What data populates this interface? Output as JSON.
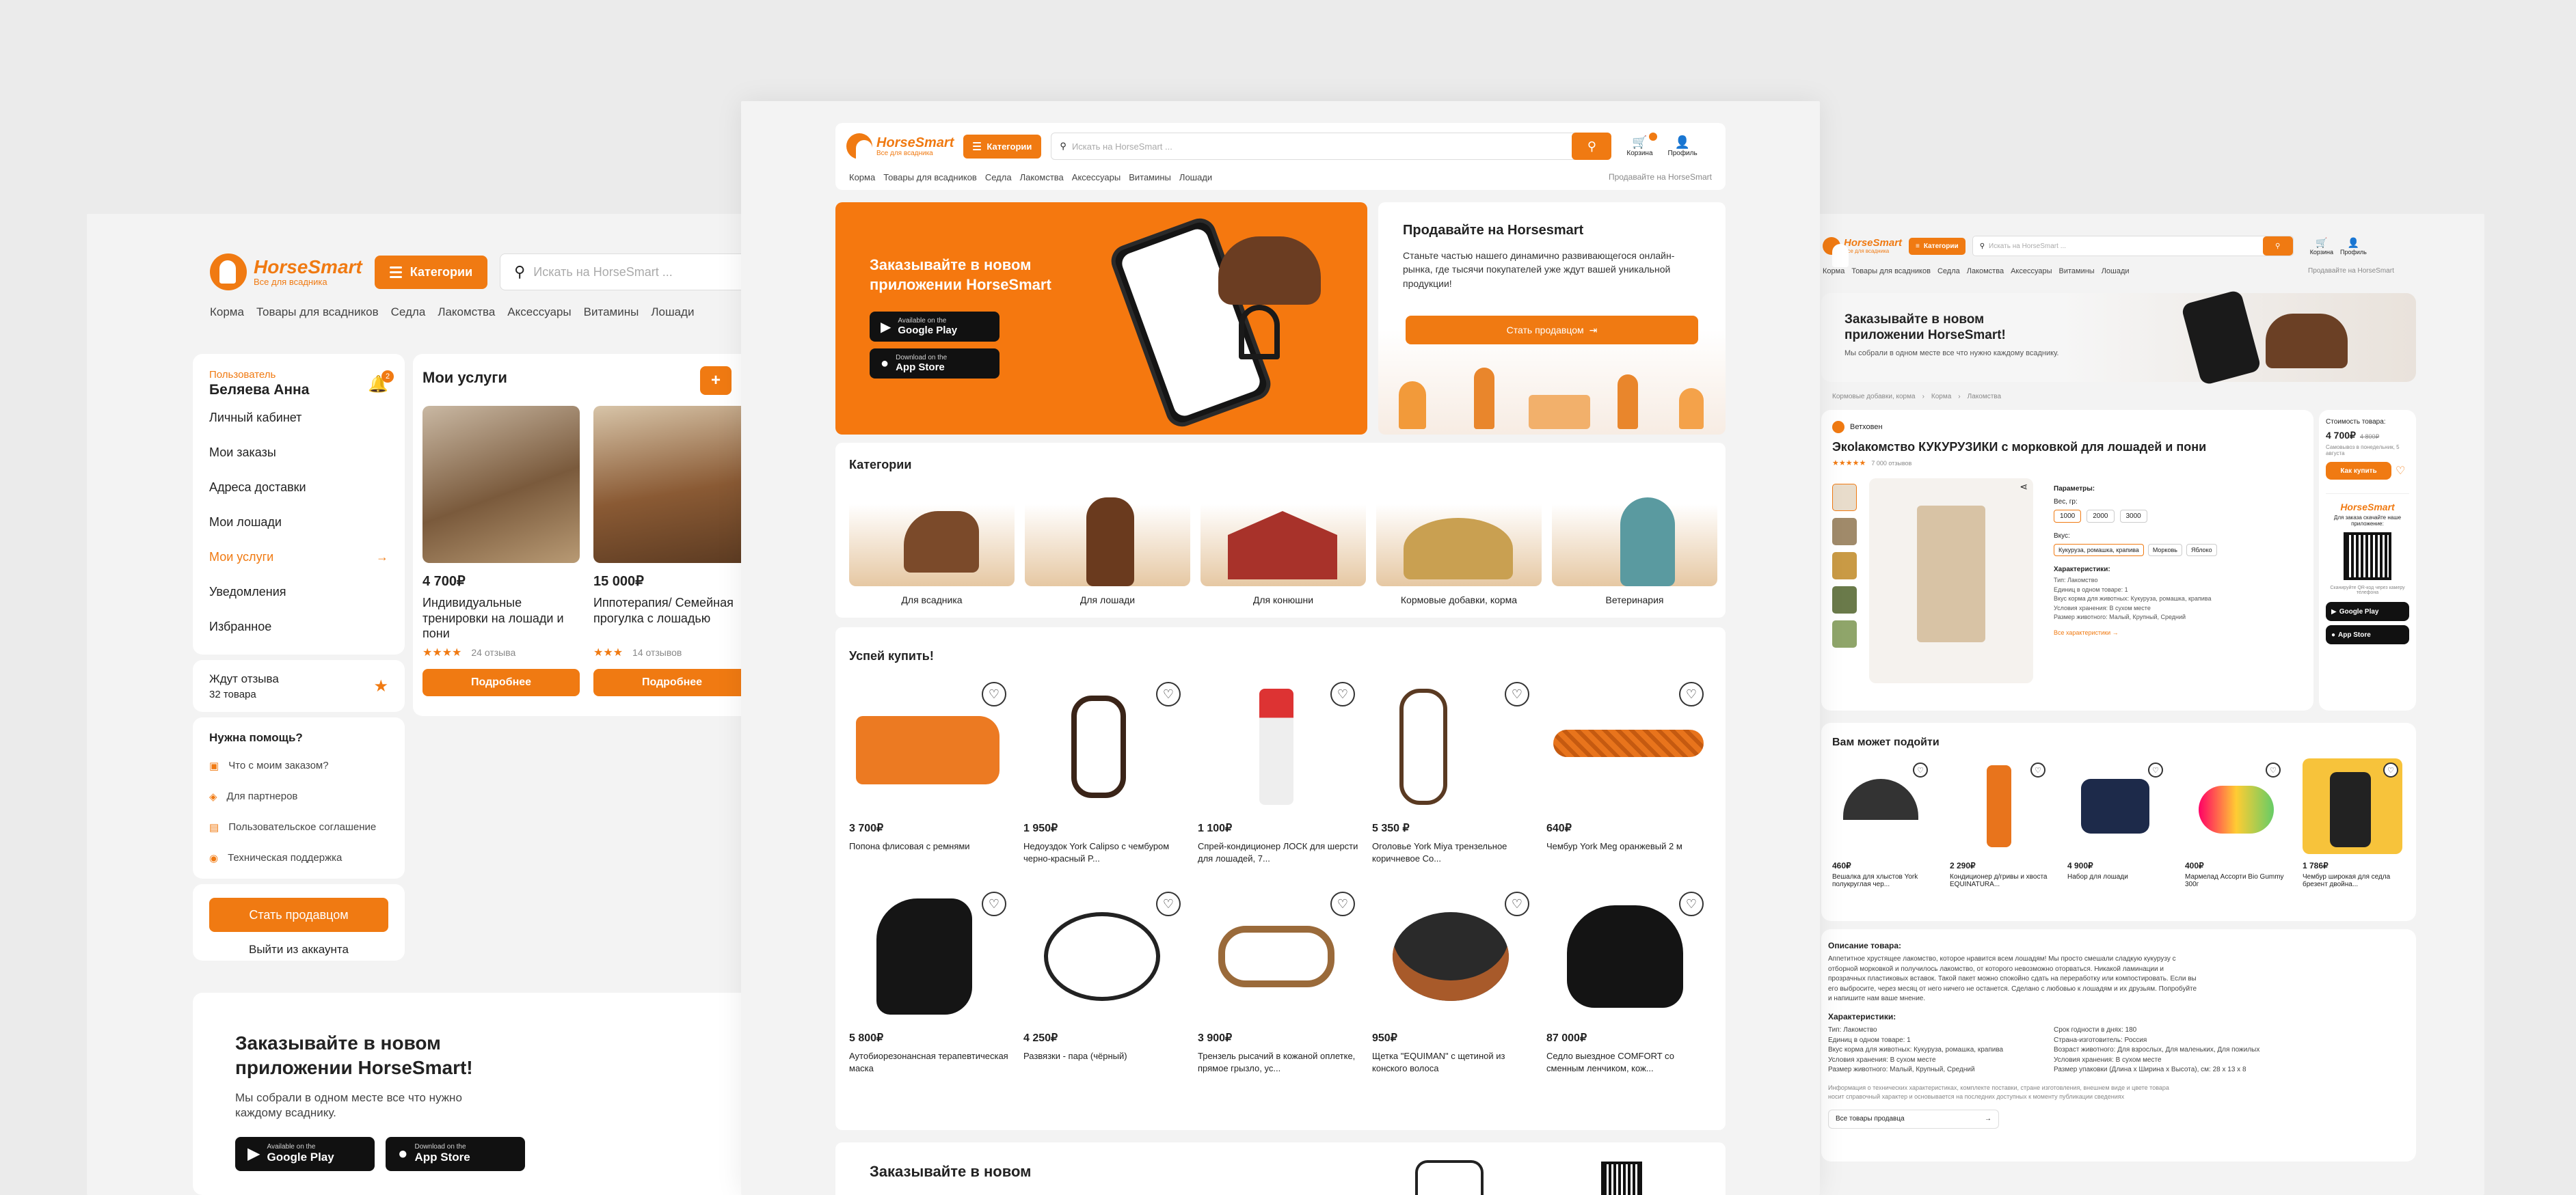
{
  "brand": {
    "name": "HorseSmart",
    "tagline": "Все для всадника"
  },
  "header": {
    "categories": "Категории",
    "search_placeholder": "Искать на HorseSmart ...",
    "cart": "Корзина",
    "profile": "Профиль",
    "sell": "Продавайте на HorseSmart"
  },
  "nav": [
    "Корма",
    "Товары для всадников",
    "Седла",
    "Лакомства",
    "Аксессуары",
    "Витамины",
    "Лошади"
  ],
  "left": {
    "user_role": "Пользователь",
    "user_name": "Беляева Анна",
    "notif_count": "2",
    "menu": [
      "Личный кабинет",
      "Мои заказы",
      "Адреса доставки",
      "Мои лошади",
      "Мои услуги",
      "Уведомления",
      "Избранное"
    ],
    "reviews_title": "Ждут отзыва",
    "reviews_count": "32 товара",
    "help_title": "Нужна помощь?",
    "help": [
      "Что с моим заказом?",
      "Для партнеров",
      "Пользовательское соглашение",
      "Техническая поддержка"
    ],
    "become_seller": "Стать продавцом",
    "logout": "Выйти из аккаунта",
    "services_title": "Мои услуги",
    "services": [
      {
        "price": "4 700₽",
        "title": "Индивидуальные тренировки на лошади и пони",
        "stars": "★★★★",
        "reviews": "24 отзыва",
        "btn": "Подробнее"
      },
      {
        "price": "15 000₽",
        "title": "Иппотерапия/ Семейная прогулка с лошадью",
        "stars": "★★★",
        "reviews": "14 отзывов",
        "btn": "Подробнее"
      }
    ],
    "promo_title": "Заказывайте в новом приложении HorseSmart!",
    "promo_text": "Мы собрали в одном месте все что нужно каждому всаднику."
  },
  "stores": {
    "gp_small": "Available on the",
    "gp": "Google Play",
    "as_small": "Download on the",
    "as": "App Store"
  },
  "center": {
    "banner_title": "Заказывайте в новом приложении HorseSmart",
    "sell_title": "Продавайте на Horsesmart",
    "sell_text": "Станьте частью нашего динамично развивающегося онлайн-рынка, где тысячи покупателей уже ждут вашей уникальной продукции!",
    "sell_btn": "Стать продавцом",
    "categories_title": "Категории",
    "categories": [
      "Для всадника",
      "Для лошади",
      "Для конюшни",
      "Кормовые добавки, корма",
      "Ветеринария"
    ],
    "hurry_title": "Успей купить!",
    "products": [
      {
        "price": "3 700₽",
        "name": "Попона флисовая с ремнями"
      },
      {
        "price": "1 950₽",
        "name": "Недоуздок York Calipso с чембуром черно-красный P..."
      },
      {
        "price": "1 100₽",
        "name": "Спрей-кондиционер ЛОСК для шерсти для лошадей, 7..."
      },
      {
        "price": "5 350 ₽",
        "name": "Оголовье York Miya трензельное коричневое Co..."
      },
      {
        "price": "640₽",
        "name": "Чембур York Meg оранжевый 2 м"
      },
      {
        "price": "5 800₽",
        "name": "Аутобиорезонансная терапевтическая маска"
      },
      {
        "price": "4 250₽",
        "name": "Развязки - пара (чёрный)"
      },
      {
        "price": "3 900₽",
        "name": "Трензель рысачий в кожаной оплетке, прямое грызло, ус..."
      },
      {
        "price": "950₽",
        "name": "Щетка \"EQUIMAN\" с щетиной из конского волоса"
      },
      {
        "price": "87 000₽",
        "name": "Седло выездное COMFORT со сменным ленчиком, кож..."
      }
    ],
    "bottom_promo": "Заказывайте в новом"
  },
  "right": {
    "banner_title": "Заказывайте в новом приложении HorseSmart!",
    "banner_text": "Мы собрали в одном месте все что нужно каждому всаднику.",
    "breadcrumbs": [
      "Кормовые добавки, корма",
      "Корма",
      "Лакомства"
    ],
    "seller": "Ветховен",
    "title": "Экolакомство КУКУРУЗИКИ с морковкой для лошадей и пони",
    "rating": "★★★★★",
    "reviews": "7 000 отзывов",
    "params_title": "Параметры:",
    "weight_label": "Вес, гр:",
    "weights": [
      "1000",
      "2000",
      "3000"
    ],
    "taste_label": "Вкус:",
    "tastes": [
      "Кукуруза, ромашка, крапива",
      "Морковь",
      "Яблоко"
    ],
    "chars_title": "Характеристики:",
    "chars": [
      "Тип: Лакомство",
      "Единиц в одном товаре: 1",
      "Вкус корма для животных: Кукуруза, ромашка, крапива",
      "Условия хранения: В сухом месте",
      "Размер животного: Малый, Крупный, Средний"
    ],
    "all_chars": "Все характеристики →",
    "cost_label": "Стоимость товара:",
    "price": "4 700₽",
    "old_price": "4 800₽",
    "pickup": "Самовывоз в понедельник, 5 августа",
    "buy_btn": "Как купить",
    "app_text": "Для заказа скачайте наше приложение:",
    "qr_text": "Сканируйте QR-код через камеру телефона",
    "fit_title": "Вам может подойти",
    "fit": [
      {
        "price": "460₽",
        "name": "Вешалка для хлыстов York полукруглая чер..."
      },
      {
        "price": "2 290₽",
        "name": "Кондиционер д/гривы и хвоста EQUINATURA..."
      },
      {
        "price": "4 900₽",
        "name": "Набор для лошади"
      },
      {
        "price": "400₽",
        "name": "Мармелад Ассорти Bio Gummy 300г"
      },
      {
        "price": "1 786₽",
        "name": "Чембур широкая для седла брезент двойна..."
      }
    ],
    "desc_title": "Описание товара:",
    "desc": "Аппетитное хрустящее лакомство, которое нравится всем лошадям! Мы просто смешали сладкую кукурузу с отборной морковкой и получилось лакомство, от которого невозможно оторваться. Никакой ламинации и прозрачных пластиковых вставок. Такой пакет можно спокойно сдать на переработку или компостировать. Если вы его выбросите, через месяц от него ничего не останется. Сделано с любовью к лошадям и их друзьям. Попробуйте и напишите нам ваше мнение.",
    "chars2_title": "Характеристики:",
    "chars2_left": [
      "Тип: Лакомство",
      "Единиц в одном товаре: 1",
      "Вкус корма для животных: Кукуруза, ромашка, крапива",
      "Условия хранения: В сухом месте",
      "Размер животного: Малый, Крупный, Средний"
    ],
    "chars2_right": [
      "Срок годности в днях: 180",
      "Страна-изготовитель: Россия",
      "Возраст животного: Для взрослых, Для маленьких, Для пожилых",
      "Условия хранения: В сухом месте",
      "Размер упаковки (Длина x Ширина x Высота), см: 28 x 13 x 8"
    ],
    "note": "Информация о технических характеристиках, комплекте поставки, стране изготовления, внешнем виде и цвете товара носит справочный характер и основывается на последних доступных к моменту публикации сведениях",
    "all_seller": "Все товары продавца"
  },
  "colors": {
    "accent": "#f07a12",
    "bg": "#ebebeb"
  }
}
